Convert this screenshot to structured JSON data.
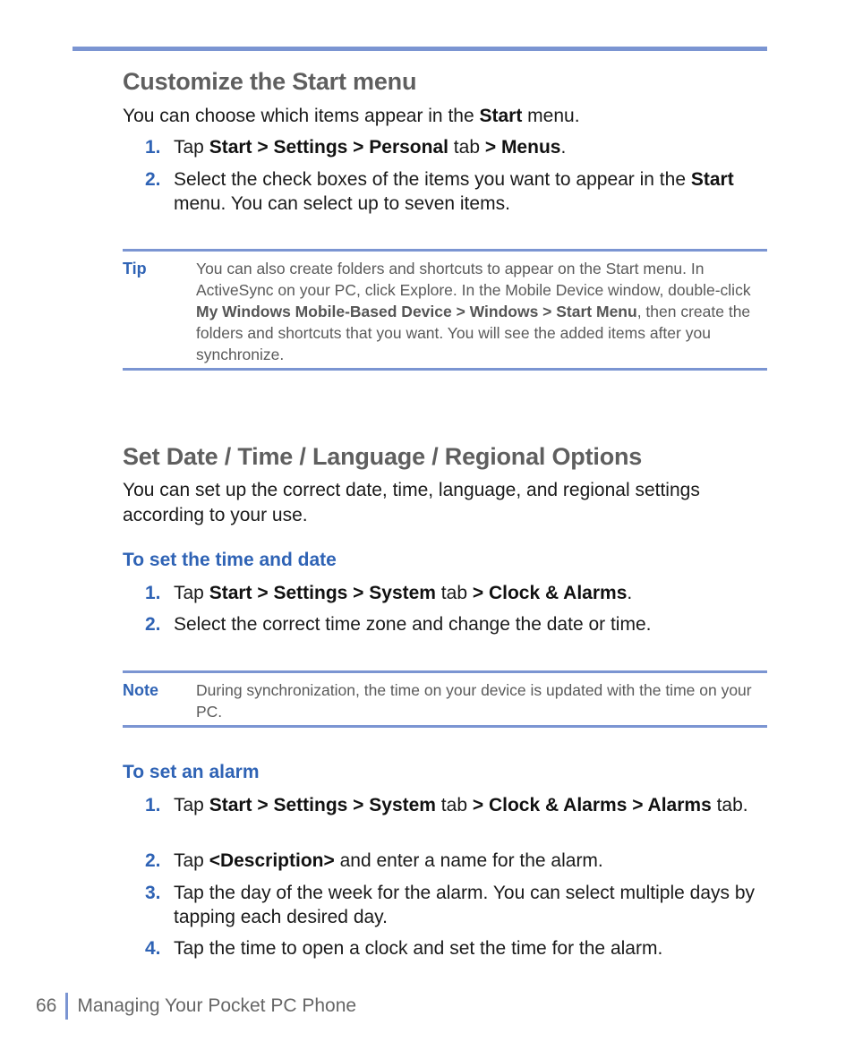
{
  "section1": {
    "title": "Customize the Start menu",
    "intro": {
      "pre": "You can choose which items appear in the ",
      "bold": "Start",
      "post": " menu."
    },
    "steps": [
      {
        "num": "1.",
        "parts": [
          [
            "t",
            "Tap "
          ],
          [
            "b",
            "Start > Settings > Personal"
          ],
          [
            "t",
            " tab "
          ],
          [
            "b",
            "> Menus"
          ],
          [
            "t",
            "."
          ]
        ]
      },
      {
        "num": "2.",
        "parts": [
          [
            "t",
            "Select the check boxes of the items you want to appear in the "
          ],
          [
            "b",
            "Start"
          ],
          [
            "t",
            " menu. You can select up to seven items."
          ]
        ]
      }
    ],
    "tip": {
      "label": "Tip",
      "parts": [
        [
          "t",
          "You can also create folders and shortcuts to appear on the Start menu. In ActiveSync on your PC, click Explore. In the Mobile Device window, double-click "
        ],
        [
          "b",
          "My Windows Mobile-Based Device > Windows > Start Menu"
        ],
        [
          "t",
          ", then create the folders and shortcuts that you want. You will see the added items after you synchronize."
        ]
      ]
    }
  },
  "section2": {
    "title": "Set Date / Time / Language / Regional Options",
    "intro": "You can set up the correct date, time, language, and regional settings according to your use.",
    "sub1": {
      "title": "To set the time and date",
      "steps": [
        {
          "num": "1.",
          "parts": [
            [
              "t",
              "Tap "
            ],
            [
              "b",
              "Start > Settings > System"
            ],
            [
              "t",
              " tab "
            ],
            [
              "b",
              "> Clock & Alarms"
            ],
            [
              "t",
              "."
            ]
          ]
        },
        {
          "num": "2.",
          "parts": [
            [
              "t",
              "Select the correct time zone and change the date or time."
            ]
          ]
        }
      ]
    },
    "note": {
      "label": "Note",
      "text": "During synchronization, the time on your device is updated with the time on your PC."
    },
    "sub2": {
      "title": "To set an alarm",
      "steps": [
        {
          "num": "1.",
          "parts": [
            [
              "t",
              "Tap "
            ],
            [
              "b",
              "Start > Settings > System"
            ],
            [
              "t",
              " tab "
            ],
            [
              "b",
              "> Clock & Alarms > Alarms"
            ],
            [
              "t",
              " tab."
            ]
          ]
        },
        {
          "num": "2.",
          "parts": [
            [
              "t",
              "Tap "
            ],
            [
              "b",
              "<Description>"
            ],
            [
              "t",
              " and enter a name for the alarm."
            ]
          ]
        },
        {
          "num": "3.",
          "parts": [
            [
              "t",
              "Tap the day of the week for the alarm. You can select multiple days by tapping each desired day."
            ]
          ]
        },
        {
          "num": "4.",
          "parts": [
            [
              "t",
              "Tap the time to open a clock and set the time for the alarm."
            ]
          ]
        }
      ]
    }
  },
  "footer": {
    "page_number": "66",
    "chapter": "Managing Your Pocket PC Phone"
  }
}
